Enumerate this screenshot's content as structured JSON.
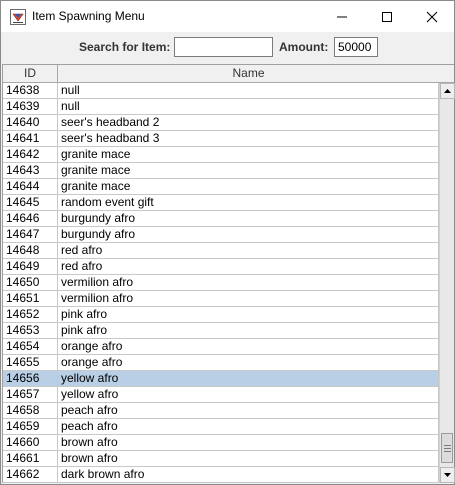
{
  "window": {
    "title": "Item Spawning Menu",
    "app_icon": "java-cup-icon",
    "controls": {
      "minimize": "minimize-icon",
      "maximize": "maximize-icon",
      "close": "close-icon"
    }
  },
  "search": {
    "search_label": "Search for Item:",
    "search_value": "",
    "amount_label": "Amount:",
    "amount_value": "50000"
  },
  "table": {
    "columns": {
      "id": "ID",
      "name": "Name"
    },
    "selected_id": "14656",
    "selection_color": "#b8cfe5",
    "rows": [
      {
        "id": "14638",
        "name": "null"
      },
      {
        "id": "14639",
        "name": "null"
      },
      {
        "id": "14640",
        "name": "seer's headband 2"
      },
      {
        "id": "14641",
        "name": "seer's headband 3"
      },
      {
        "id": "14642",
        "name": "granite mace"
      },
      {
        "id": "14643",
        "name": "granite mace"
      },
      {
        "id": "14644",
        "name": "granite mace"
      },
      {
        "id": "14645",
        "name": "random event gift"
      },
      {
        "id": "14646",
        "name": "burgundy afro"
      },
      {
        "id": "14647",
        "name": "burgundy afro"
      },
      {
        "id": "14648",
        "name": "red afro"
      },
      {
        "id": "14649",
        "name": "red afro"
      },
      {
        "id": "14650",
        "name": "vermilion afro"
      },
      {
        "id": "14651",
        "name": "vermilion afro"
      },
      {
        "id": "14652",
        "name": "pink afro"
      },
      {
        "id": "14653",
        "name": "pink afro"
      },
      {
        "id": "14654",
        "name": "orange afro"
      },
      {
        "id": "14655",
        "name": "orange afro"
      },
      {
        "id": "14656",
        "name": "yellow afro"
      },
      {
        "id": "14657",
        "name": "yellow afro"
      },
      {
        "id": "14658",
        "name": "peach afro"
      },
      {
        "id": "14659",
        "name": "peach afro"
      },
      {
        "id": "14660",
        "name": "brown afro"
      },
      {
        "id": "14661",
        "name": "brown afro"
      },
      {
        "id": "14662",
        "name": "dark brown afro"
      }
    ]
  },
  "scrollbar": {
    "position_fraction": 0.99
  }
}
